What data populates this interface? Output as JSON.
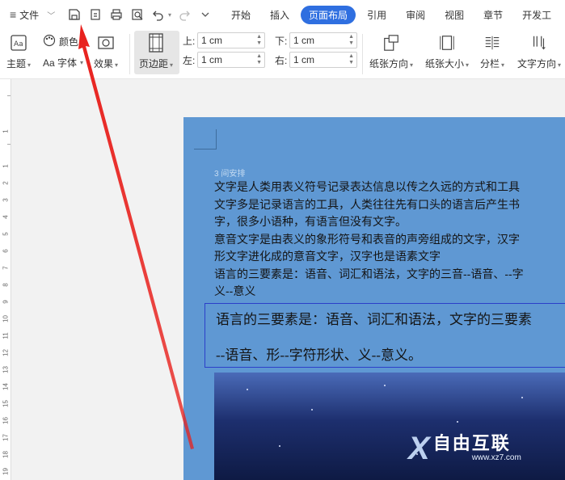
{
  "menubar": {
    "file_label": "文件",
    "tabs": [
      "开始",
      "插入",
      "页面布局",
      "引用",
      "审阅",
      "视图",
      "章节",
      "开发工"
    ],
    "active_tab": "页面布局"
  },
  "ribbon": {
    "theme_label": "主题",
    "color_label": "颜色",
    "font_label": "Aa 字体",
    "effect_label": "效果",
    "margin_label": "页边距",
    "margins": {
      "top_label": "上:",
      "top_value": "1 cm",
      "left_label": "左:",
      "left_value": "1 cm",
      "bottom_label": "下:",
      "bottom_value": "1 cm",
      "right_label": "右:",
      "right_value": "1 cm"
    },
    "orientation_label": "纸张方向",
    "size_label": "纸张大小",
    "columns_label": "分栏",
    "direction_label": "文字方向"
  },
  "ruler": {
    "numbers": [
      "1",
      "1",
      "2",
      "3",
      "4",
      "5",
      "6",
      "7",
      "8",
      "9",
      "10",
      "11",
      "12",
      "13",
      "14",
      "15",
      "16",
      "17",
      "18",
      "19"
    ]
  },
  "document": {
    "hint": "3 间安排",
    "lines": [
      "文字是人类用表义符号记录表达信息以传之久远的方式和工具",
      "文字多是记录语言的工具，人类往往先有口头的语言后产生书",
      "字，很多小语种，有语言但没有文字。",
      "意音文字是由表义的象形符号和表音的声旁组成的文字，汉字",
      "形文字进化成的意音文字，汉字也是语素文字",
      "语言的三要素是：语音、词汇和语法，文字的三音--语音、--字",
      "义--意义"
    ],
    "textbox_lines": [
      "语言的三要素是：语音、词汇和语法，文字的三要素",
      "--语音、形--字符形状、义--意义。"
    ]
  },
  "watermark": {
    "brand": "自由互联",
    "url": "www.xz7.com"
  },
  "colors": {
    "accent": "#2f6fe0",
    "page_fill": "#5f98d3",
    "arrow": "#e8201c"
  }
}
